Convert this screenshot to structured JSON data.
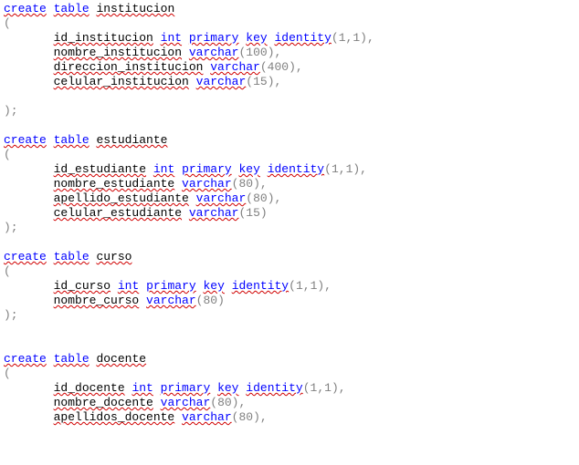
{
  "code": {
    "l1_kw1": "create",
    "l1_kw2": "table",
    "l1_id": "institucion",
    "l2": "(",
    "l3_id": "id_institucion",
    "l3_kw1": "int",
    "l3_kw2": "primary",
    "l3_kw3": "key",
    "l3_kw4": "identity",
    "l3_p1": "(",
    "l3_n1": "1",
    "l3_c1": ",",
    "l3_n2": "1",
    "l3_p2": "),",
    "l4_id": "nombre_institucion",
    "l4_kw": "varchar",
    "l4_p1": "(",
    "l4_n": "100",
    "l4_p2": "),",
    "l5_id": "direccion_institucion",
    "l5_kw": "varchar",
    "l5_p1": "(",
    "l5_n": "400",
    "l5_p2": "),",
    "l6_id": "celular_institucion",
    "l6_kw": "varchar",
    "l6_p1": "(",
    "l6_n": "15",
    "l6_p2": "),",
    "l7": "",
    "l8": ");",
    "l9": "",
    "l10_kw1": "create",
    "l10_kw2": "table",
    "l10_id": "estudiante",
    "l11": "(",
    "l12_id": "id_estudiante",
    "l12_kw1": "int",
    "l12_kw2": "primary",
    "l12_kw3": "key",
    "l12_kw4": "identity",
    "l12_p1": "(",
    "l12_n1": "1",
    "l12_c1": ",",
    "l12_n2": "1",
    "l12_p2": "),",
    "l13_id": "nombre_estudiante",
    "l13_kw": "varchar",
    "l13_p1": "(",
    "l13_n": "80",
    "l13_p2": "),",
    "l14_id": "apellido_estudiante",
    "l14_kw": "varchar",
    "l14_p1": "(",
    "l14_n": "80",
    "l14_p2": "),",
    "l15_id": "celular_estudiante",
    "l15_kw": "varchar",
    "l15_p1": "(",
    "l15_n": "15",
    "l15_p2": ")",
    "l16": ");",
    "l17": "",
    "l18_kw1": "create",
    "l18_kw2": "table",
    "l18_id": "curso",
    "l19": "(",
    "l20_id": "id_curso",
    "l20_kw1": "int",
    "l20_kw2": "primary",
    "l20_kw3": "key",
    "l20_kw4": "identity",
    "l20_p1": "(",
    "l20_n1": "1",
    "l20_c1": ",",
    "l20_n2": "1",
    "l20_p2": "),",
    "l21_id": "nombre_curso",
    "l21_kw": "varchar",
    "l21_p1": "(",
    "l21_n": "80",
    "l21_p2": ")",
    "l22": ");",
    "l23": "",
    "l24": "",
    "l25_kw1": "create",
    "l25_kw2": "table",
    "l25_id": "docente",
    "l26": "(",
    "l27_id": "id_docente",
    "l27_kw1": "int",
    "l27_kw2": "primary",
    "l27_kw3": "key",
    "l27_kw4": "identity",
    "l27_p1": "(",
    "l27_n1": "1",
    "l27_c1": ",",
    "l27_n2": "1",
    "l27_p2": "),",
    "l28_id": "nombre_docente",
    "l28_kw": "varchar",
    "l28_p1": "(",
    "l28_n": "80",
    "l28_p2": "),",
    "l29_id": "apellidos_docente",
    "l29_kw": "varchar",
    "l29_p1": "(",
    "l29_n": "80",
    "l29_p2": "),"
  }
}
